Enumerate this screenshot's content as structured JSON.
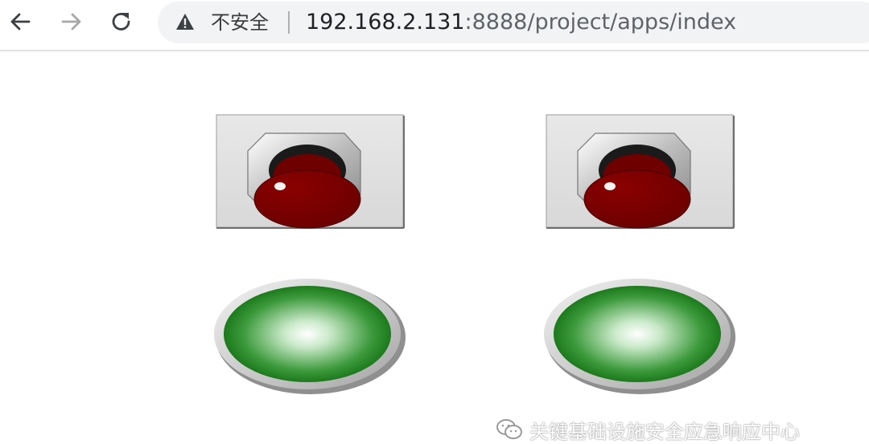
{
  "browser": {
    "security_label": "不安全",
    "url_host": "192.168.2.131",
    "url_rest": ":8888/project/apps/index",
    "icons": {
      "back": "arrow-left-icon",
      "forward": "arrow-right-icon",
      "reload": "reload-icon",
      "warning": "warning-triangle-icon"
    }
  },
  "hmi": {
    "stop_buttons": [
      {
        "name": "stop-button-1",
        "color": "#7a0000"
      },
      {
        "name": "stop-button-2",
        "color": "#7a0000"
      }
    ],
    "indicator_lights": [
      {
        "name": "indicator-light-1",
        "color": "#1b8a1b",
        "state": "on"
      },
      {
        "name": "indicator-light-2",
        "color": "#1b8a1b",
        "state": "on"
      }
    ]
  },
  "watermark": {
    "text": "关键基础设施安全应急响应中心",
    "icon": "wechat-icon"
  }
}
